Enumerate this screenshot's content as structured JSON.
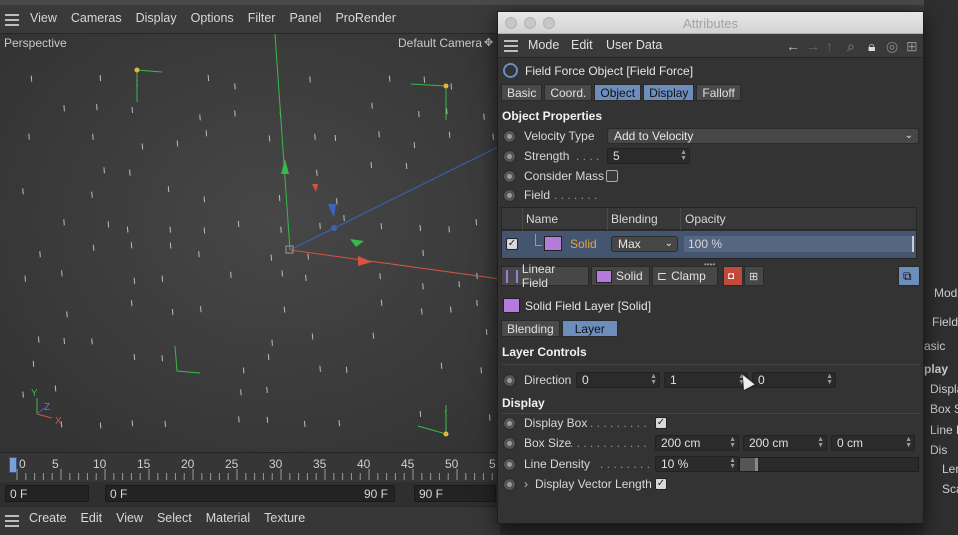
{
  "main_menu": [
    "View",
    "Cameras",
    "Display",
    "Options",
    "Filter",
    "Panel",
    "ProRender"
  ],
  "viewport": {
    "name": "Perspective",
    "camera": "Default Camera",
    "axis_labels": {
      "y": "Y",
      "z": "Z",
      "x": "X"
    }
  },
  "timeline": {
    "ticks": [
      "0",
      "5",
      "10",
      "15",
      "20",
      "25",
      "30",
      "35",
      "40",
      "45",
      "50",
      "5"
    ],
    "frame_current": "0 F",
    "range_start": "0 F",
    "range_end": "90 F",
    "frame_max": "90 F"
  },
  "bottom_menu": [
    "Create",
    "Edit",
    "View",
    "Select",
    "Material",
    "Texture"
  ],
  "attributes": {
    "window_title": "Attributes",
    "menu": [
      "Mode",
      "Edit",
      "User Data"
    ],
    "object_title": "Field Force Object [Field Force]",
    "tabs": [
      {
        "label": "Basic",
        "active": false
      },
      {
        "label": "Coord.",
        "active": false
      },
      {
        "label": "Object",
        "active": true
      },
      {
        "label": "Display",
        "active": true
      },
      {
        "label": "Falloff",
        "active": false
      }
    ],
    "object_properties": {
      "header": "Object Properties",
      "velocity_type_label": "Velocity Type",
      "velocity_type_value": "Add to Velocity",
      "strength_label": "Strength",
      "strength_dots": ". . . .",
      "strength_value": "5",
      "consider_mass_label": "Consider Mass",
      "consider_mass_checked": false,
      "field_label": "Field",
      "field_dots": ". . . . . . ."
    },
    "field_list": {
      "columns": [
        "Name",
        "Blending",
        "Opacity"
      ],
      "rows": [
        {
          "enabled": true,
          "name": "Solid",
          "blending": "Max",
          "opacity": "100 %"
        }
      ]
    },
    "toolbar": {
      "linear_field": "Linear Field",
      "solid": "Solid",
      "clamp": "Clamp"
    },
    "layer_title": "Solid Field Layer [Solid]",
    "layer_tabs": [
      {
        "label": "Blending",
        "active": false
      },
      {
        "label": "Layer",
        "active": true
      }
    ],
    "layer_controls": {
      "header": "Layer Controls",
      "direction_label": "Direction",
      "direction": [
        "0",
        "1",
        "0"
      ]
    },
    "display": {
      "header": "Display",
      "display_box_label": "Display Box",
      "display_box_dots": ". . . . . . . . .",
      "display_box_checked": true,
      "box_size_label": "Box Size",
      "box_size_dots": ". . . . . . . . . . . .",
      "box_size": [
        "200 cm",
        "200 cm",
        "0 cm"
      ],
      "line_density_label": "Line Density",
      "line_density_dots": ". . . . . . . .",
      "line_density_value": "10 %",
      "line_density_fraction": 0.1,
      "vector_length_label": "Display Vector Length",
      "vector_length_checked": true
    }
  },
  "right_panel": [
    "Mod",
    "Field",
    "asic",
    "play",
    "Displa",
    "Box S",
    "Line D",
    "Dis",
    "Len",
    "Sca"
  ],
  "colors": {
    "tab_active": "#6d8ebd",
    "solid_swatch": "#b57bdc",
    "solid_name": "#e8a33a",
    "axis_x": "#d2553f",
    "axis_y": "#39b94a",
    "axis_z": "#3d63b8",
    "corner_point": "#e8b43a"
  }
}
